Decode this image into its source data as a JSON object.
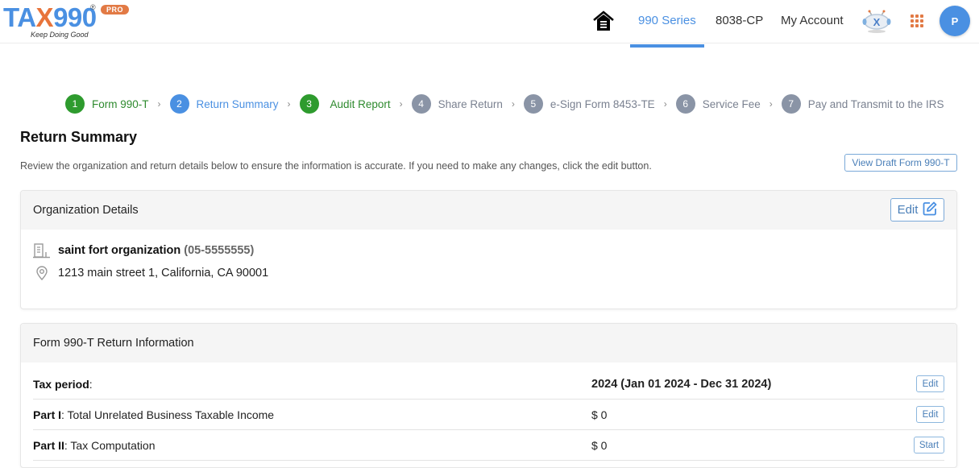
{
  "header": {
    "logo_text_left": "TA",
    "logo_text_x": "X",
    "logo_text_right": "990",
    "logo_reg": "®",
    "logo_badge": "PRO",
    "logo_tagline": "Keep Doing Good",
    "nav": [
      {
        "label": "990 Series",
        "active": true
      },
      {
        "label": "8038-CP",
        "active": false
      },
      {
        "label": "My Account",
        "active": false
      }
    ],
    "avatar_initial": "P",
    "brand_color": "#4a90e2",
    "accent_color": "#e27a45"
  },
  "stepper": [
    {
      "num": "1",
      "label": "Form 990-T",
      "state": "done"
    },
    {
      "num": "2",
      "label": "Return Summary",
      "state": "current"
    },
    {
      "num": "3",
      "label": "Audit Report",
      "state": "done"
    },
    {
      "num": "4",
      "label": "Share Return",
      "state": "pending"
    },
    {
      "num": "5",
      "label": "e-Sign Form 8453-TE",
      "state": "pending"
    },
    {
      "num": "6",
      "label": "Service Fee",
      "state": "pending"
    },
    {
      "num": "7",
      "label": "Pay and Transmit to the IRS",
      "state": "pending"
    }
  ],
  "page": {
    "title": "Return Summary",
    "description": "Review the organization and return details below to ensure the information is accurate. If you need to make any changes, click the edit button.",
    "view_draft_label": "View Draft Form 990-T"
  },
  "organization": {
    "heading": "Organization Details",
    "edit_label": "Edit",
    "name": "saint fort organization",
    "ein": "(05-5555555)",
    "address": "1213 main street 1, California, CA 90001"
  },
  "return_info": {
    "heading": "Form 990-T Return Information",
    "rows": [
      {
        "label_bold": "Tax period",
        "label_rest": ":",
        "value": "2024 (Jan 01 2024 - Dec 31 2024)",
        "action": "Edit"
      },
      {
        "label_bold": "Part I",
        "label_rest": ": Total Unrelated Business Taxable Income",
        "value": "$ 0",
        "action": "Edit"
      },
      {
        "label_bold": "Part II",
        "label_rest": ": Tax Computation",
        "value": "$ 0",
        "action": "Start"
      }
    ]
  }
}
